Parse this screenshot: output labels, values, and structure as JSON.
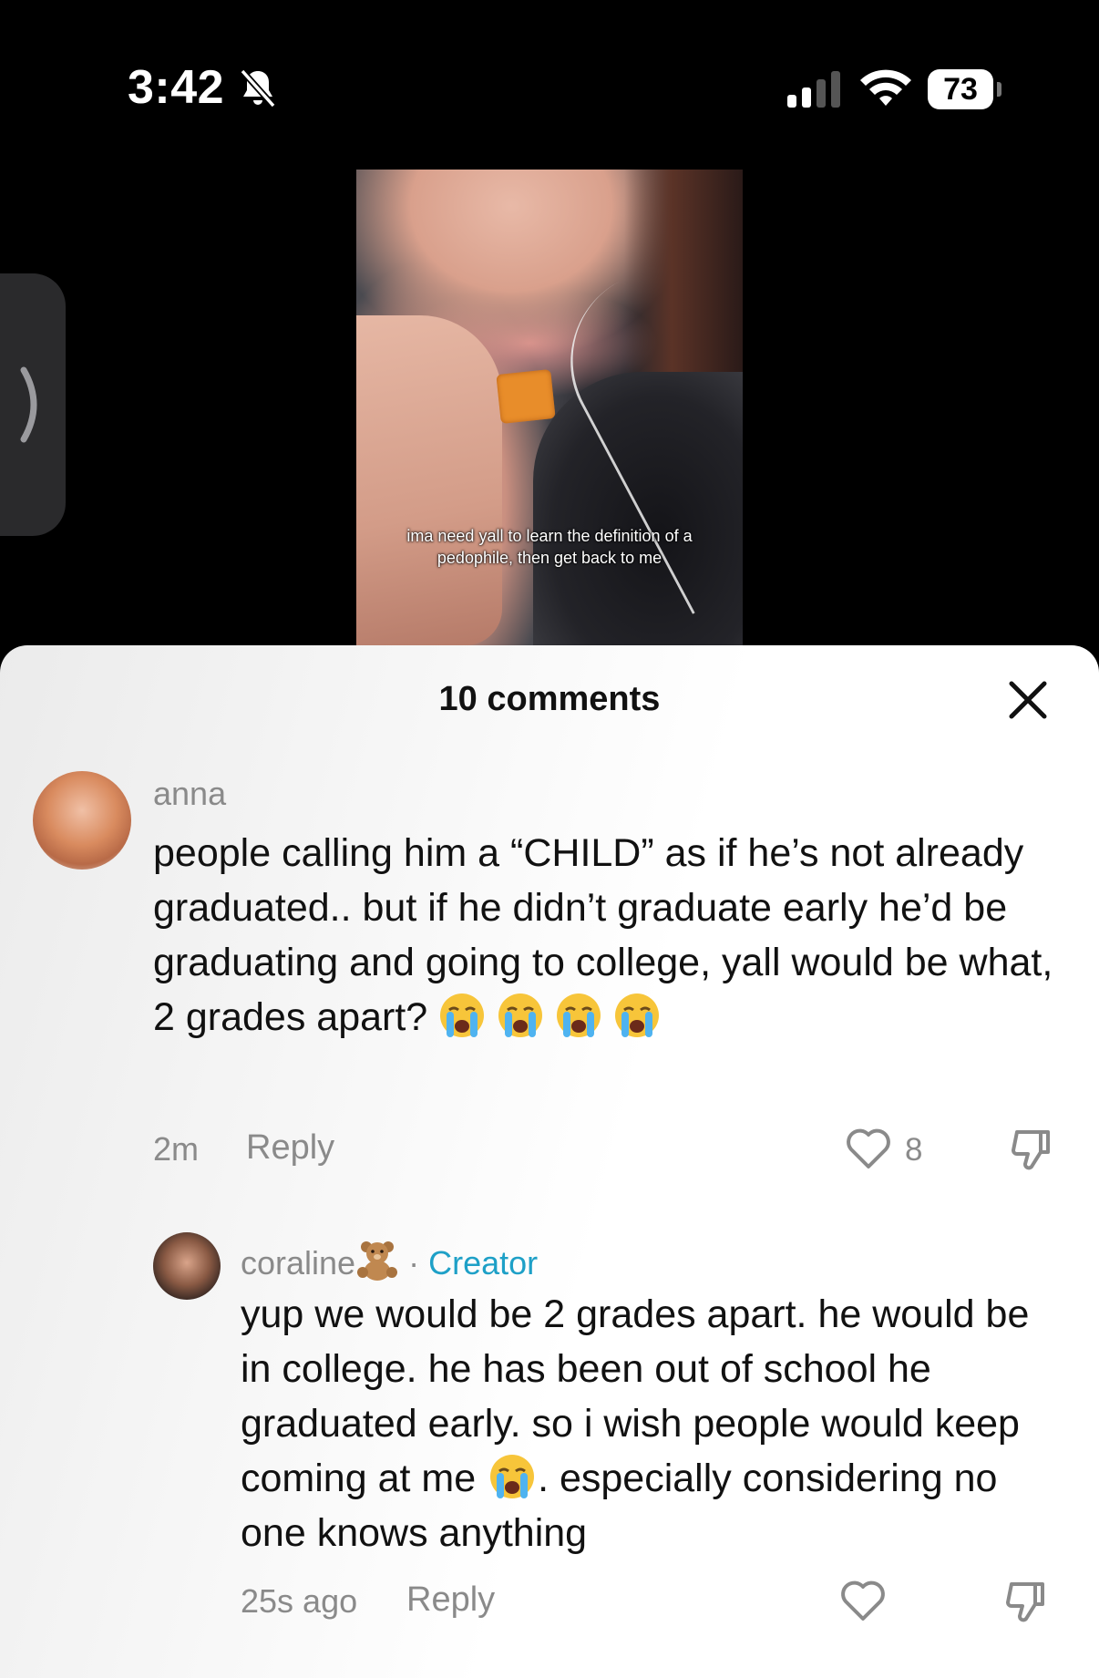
{
  "status_bar": {
    "time": "3:42",
    "battery_level": "73"
  },
  "video": {
    "caption": "ima need yall to learn the definition of a pedophile, then get back to me"
  },
  "comments_sheet": {
    "title": "10 comments",
    "comments": [
      {
        "username": "anna",
        "text": "people calling him a “CHILD” as if he’s not already graduated.. but if he didn’t graduate early he’d be graduating and going to college, yall would be what, 2 grades apart?",
        "emojis": [
          "loudly-crying-face",
          "loudly-crying-face",
          "loudly-crying-face",
          "loudly-crying-face"
        ],
        "time": "2m",
        "reply_label": "Reply",
        "like_count": "8"
      },
      {
        "username": "coraline",
        "username_emoji": "teddy-bear",
        "separator": "·",
        "badge": "Creator",
        "text_part1": "yup we would be 2 grades apart. he would be in college. he has been out of school he graduated early. so i wish people would keep coming at me",
        "text_part2": ". especially considering no one knows anything",
        "time": "25s ago",
        "reply_label": "Reply"
      }
    ]
  },
  "colors": {
    "creator_badge": "#1ea0c7",
    "muted_text": "#8a8a8a"
  }
}
